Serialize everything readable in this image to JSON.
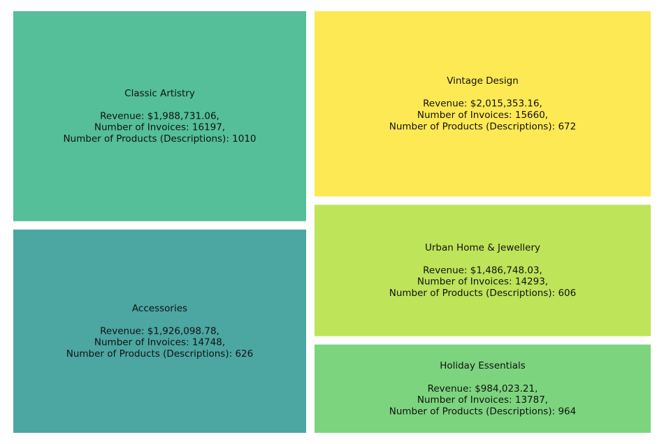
{
  "chart_data": {
    "type": "treemap",
    "tiles": [
      {
        "name": "Classic Artistry",
        "revenue_text": "Revenue: $1,988,731.06,",
        "invoices_text": "Number of Invoices: 16197,",
        "products_text": "Number of Products (Descriptions): 1010",
        "revenue": 1988731.06,
        "invoices": 16197,
        "products": 1010,
        "color": "#54bf99"
      },
      {
        "name": "Accessories",
        "revenue_text": "Revenue: $1,926,098.78,",
        "invoices_text": "Number of Invoices: 14748,",
        "products_text": "Number of Products (Descriptions): 626",
        "revenue": 1926098.78,
        "invoices": 14748,
        "products": 626,
        "color": "#4ca6a2"
      },
      {
        "name": "Vintage Design",
        "revenue_text": "Revenue: $2,015,353.16,",
        "invoices_text": "Number of Invoices: 15660,",
        "products_text": "Number of Products (Descriptions): 672",
        "revenue": 2015353.16,
        "invoices": 15660,
        "products": 672,
        "color": "#fde953"
      },
      {
        "name": "Urban Home & Jewellery",
        "revenue_text": "Revenue: $1,486,748.03,",
        "invoices_text": "Number of Invoices: 14293,",
        "products_text": "Number of Products (Descriptions): 606",
        "revenue": 1486748.03,
        "invoices": 14293,
        "products": 606,
        "color": "#bee45a"
      },
      {
        "name": "Holiday Essentials",
        "revenue_text": "Revenue: $984,023.21,",
        "invoices_text": "Number of Invoices: 13787,",
        "products_text": "Number of Products (Descriptions): 964",
        "revenue": 984023.21,
        "invoices": 13787,
        "products": 964,
        "color": "#7dd47f"
      }
    ]
  }
}
